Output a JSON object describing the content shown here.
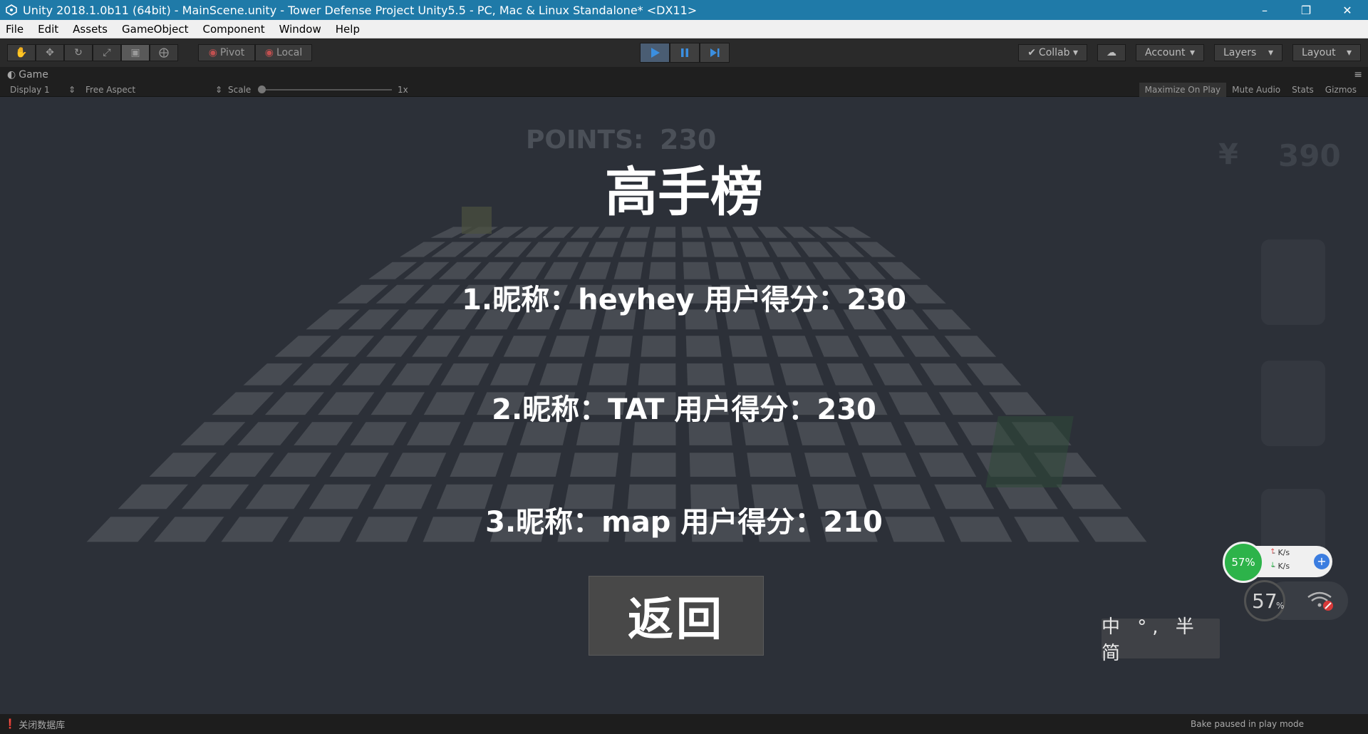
{
  "window": {
    "title": "Unity 2018.1.0b11 (64bit) - MainScene.unity - Tower Defense Project Unity5.5 - PC, Mac & Linux Standalone* <DX11>"
  },
  "menu": [
    "File",
    "Edit",
    "Assets",
    "GameObject",
    "Component",
    "Window",
    "Help"
  ],
  "toolbar": {
    "pivot_label": "Pivot",
    "local_label": "Local",
    "collab_label": "Collab",
    "account_label": "Account",
    "layers_label": "Layers",
    "layout_label": "Layout"
  },
  "game_tab": {
    "title": "Game",
    "display": "Display 1",
    "aspect": "Free Aspect",
    "scale_label": "Scale",
    "scale_value": "1x",
    "maximize_on_play": "Maximize On Play",
    "mute_audio": "Mute Audio",
    "stats": "Stats",
    "gizmos": "Gizmos"
  },
  "game": {
    "points_label": "POINTS:",
    "points_value": "230",
    "currency_symbol": "¥",
    "money_value": "390",
    "leaderboard_title": "高手榜",
    "entries": [
      "1.昵称：heyhey 用户得分：230",
      "2.昵称：TAT 用户得分：230",
      "3.昵称：map 用户得分：210"
    ],
    "return_label": "返回"
  },
  "overlay": {
    "ime_text": "中 °, 半 简",
    "cpu_percent": "57%",
    "upload_speed": "- K/s",
    "download_speed": "- K/s",
    "memory_percent": "57",
    "memory_unit": "%"
  },
  "status": {
    "left_text": "关闭数据库",
    "right_text": "Bake paused in play mode"
  },
  "colors": {
    "titlebar": "#1f7aa8",
    "editor_dark": "#2a2a2a",
    "viewport_bg": "#2c3038",
    "tile": "#474b52",
    "gauge_green": "#2db34a"
  }
}
